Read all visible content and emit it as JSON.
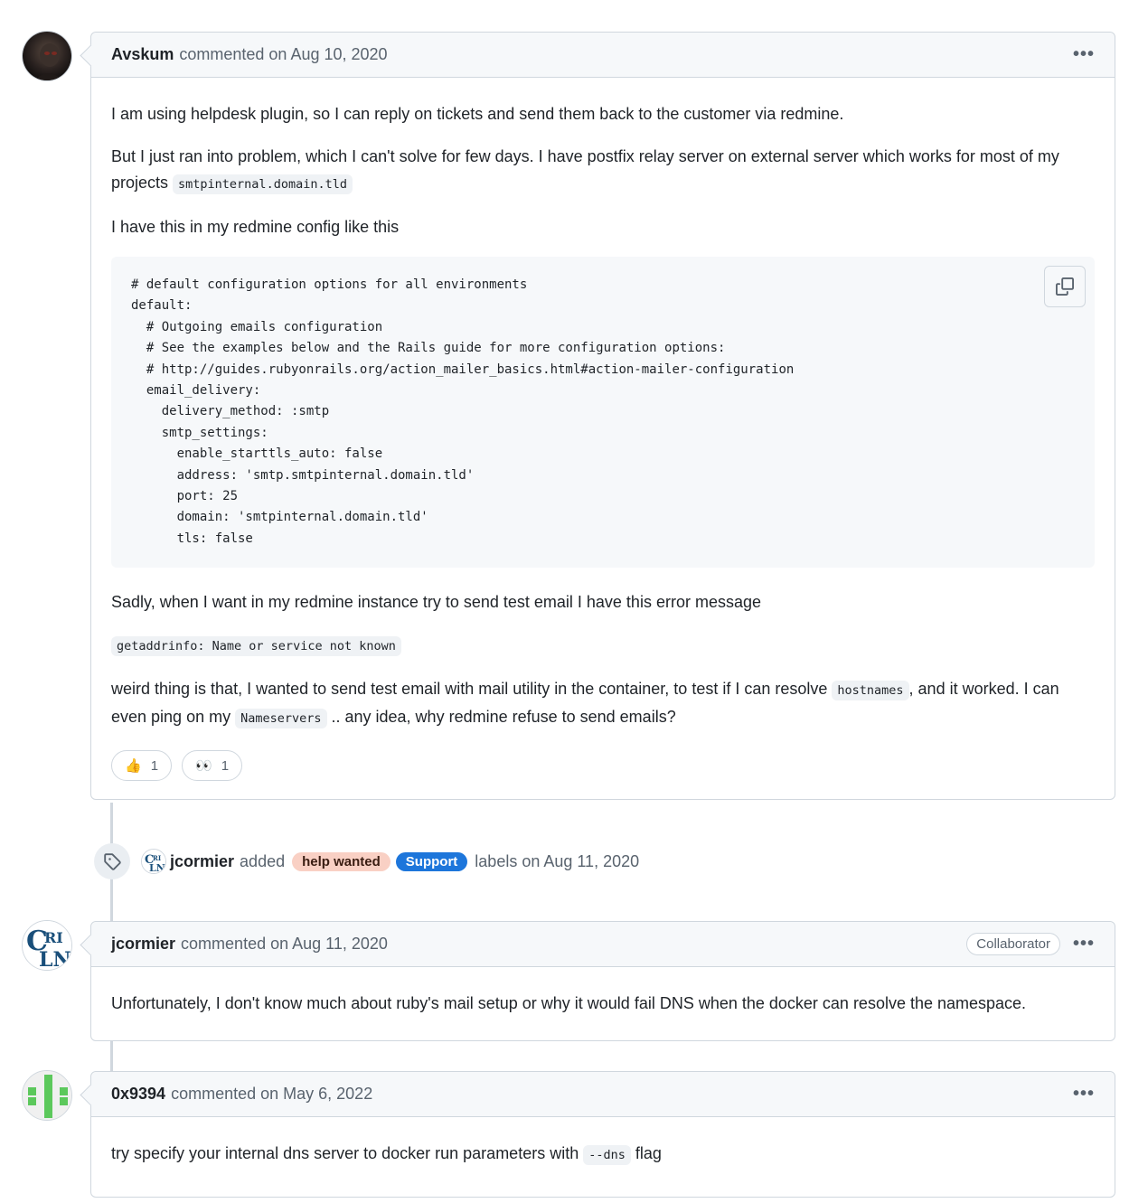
{
  "comments": [
    {
      "author": "Avskum",
      "meta": "commented on Aug 10, 2020",
      "p1": "I am using helpdesk plugin, so I can reply on tickets and send them back to the customer via redmine.",
      "p2_before": "But I just ran into problem, which I can't solve for few days. I have postfix relay server on external server which works for most of my projects ",
      "p2_code": "smtpinternal.domain.tld",
      "p3": "I have this in my redmine config like this",
      "code_block": "# default configuration options for all environments\ndefault:\n  # Outgoing emails configuration\n  # See the examples below and the Rails guide for more configuration options:\n  # http://guides.rubyonrails.org/action_mailer_basics.html#action-mailer-configuration\n  email_delivery:\n    delivery_method: :smtp\n    smtp_settings:\n      enable_starttls_auto: false\n      address: 'smtp.smtpinternal.domain.tld'\n      port: 25\n      domain: 'smtpinternal.domain.tld'\n      tls: false",
      "p4": "Sadly, when I want in my redmine instance try to send test email I have this error message",
      "error_code": "getaddrinfo: Name or service not known",
      "p5_a": "weird thing is that, I wanted to send test email with mail utility in the container, to test if I can resolve ",
      "p5_code1": "hostnames",
      "p5_b": ", and it worked. I can even ping on my ",
      "p5_code2": "Nameservers",
      "p5_c": " .. any idea, why redmine refuse to send emails?",
      "reactions": [
        {
          "emoji": "👍",
          "count": "1"
        },
        {
          "emoji": "👀",
          "count": "1"
        }
      ]
    },
    {
      "author": "jcormier",
      "meta": "commented on Aug 11, 2020",
      "role": "Collaborator",
      "body": "Unfortunately, I don't know much about ruby's mail setup or why it would fail DNS when the docker can resolve the namespace."
    },
    {
      "author": "0x9394",
      "meta": "commented on May 6, 2022",
      "body_before": "try specify your internal dns server to docker run parameters with ",
      "body_code": "--dns",
      "body_after": " flag"
    }
  ],
  "event": {
    "author": "jcormier",
    "action": "added",
    "labels": [
      {
        "name": "help wanted",
        "bg": "#f9d0c4",
        "fg": "#3a1d12"
      },
      {
        "name": "Support",
        "bg": "#1d76db",
        "fg": "#ffffff"
      }
    ],
    "suffix": "labels on Aug 11, 2020"
  },
  "kebab": "•••",
  "icons": {
    "copy": "copy-icon",
    "tag": "tag-icon",
    "kebab": "kebab-horizontal-icon"
  }
}
